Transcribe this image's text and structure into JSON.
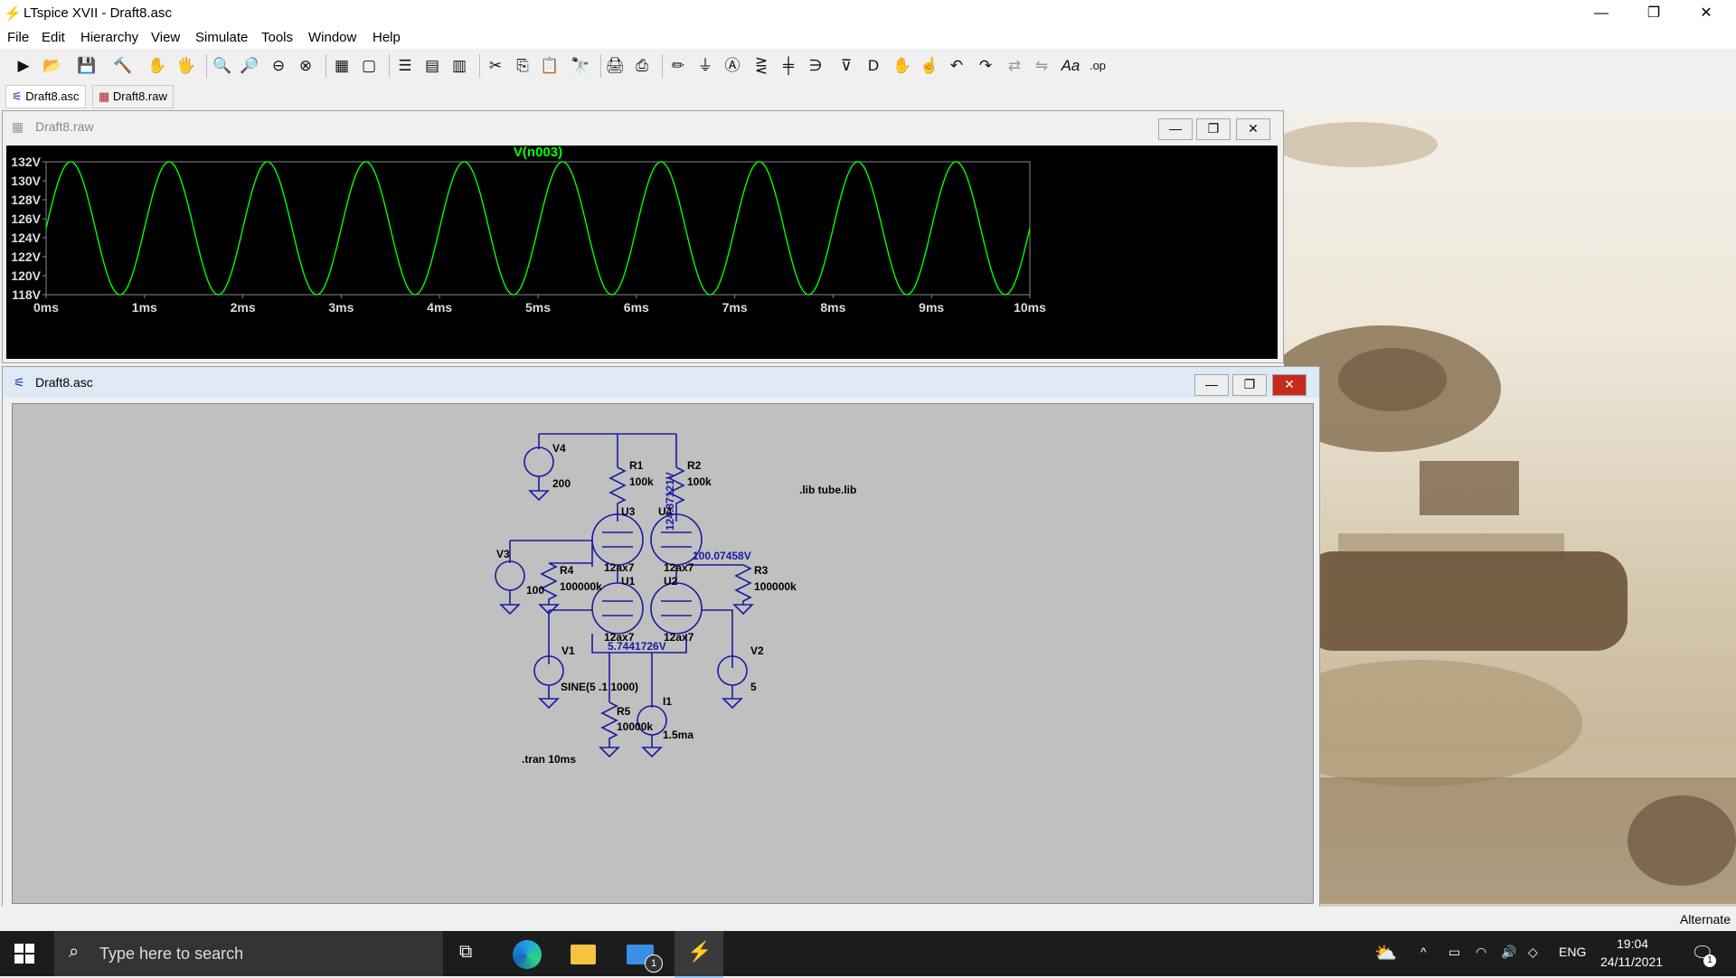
{
  "app": {
    "title": "LTspice XVII - Draft8.asc",
    "status_right": "Alternate"
  },
  "menu": [
    "File",
    "Edit",
    "Hierarchy",
    "View",
    "Simulate",
    "Tools",
    "Window",
    "Help"
  ],
  "tabs": [
    {
      "label": "Draft8.asc"
    },
    {
      "label": "Draft8.raw"
    }
  ],
  "plot_window": {
    "title": "Draft8.raw",
    "trace_label": "V(n003)",
    "trace_color": "#00ff00",
    "background": "#000000"
  },
  "chart_data": {
    "type": "line",
    "title": "V(n003)",
    "series": [
      {
        "name": "V(n003)",
        "frequency_hz": 1000,
        "offset_v": 125,
        "amplitude_v": 7,
        "phase": "peak at ~0.25ms"
      }
    ],
    "x_ticks": [
      "0ms",
      "1ms",
      "2ms",
      "3ms",
      "4ms",
      "5ms",
      "6ms",
      "7ms",
      "8ms",
      "9ms",
      "10ms"
    ],
    "y_ticks": [
      "132V",
      "130V",
      "128V",
      "126V",
      "124V",
      "122V",
      "120V",
      "118V"
    ],
    "xlim": [
      0,
      10
    ],
    "ylim": [
      118,
      132
    ],
    "x_unit": "ms",
    "y_unit": "V",
    "grid": false
  },
  "schematic_window": {
    "title": "Draft8.asc",
    "labels": {
      "v4": "V4",
      "v4_val": "200",
      "r1": "R1",
      "r1_val": "100k",
      "r2": "R2",
      "r2_val": "100k",
      "lib": ".lib tube.lib",
      "u3": "U3",
      "u4": "U4",
      "node_v1": "124.87121V",
      "node_v2": "100.07458V",
      "v3": "V3",
      "v3_val": "100",
      "r4": "R4",
      "r4_val": "100000k",
      "u3_model": "12ax7",
      "u4_model": "12ax7",
      "u1": "U1",
      "u2": "U2",
      "r3": "R3",
      "r3_val": "100000k",
      "u1_model": "12ax7",
      "u2_model": "12ax7",
      "node_v3": "5.7441726V",
      "v1": "V1",
      "v1_val": "SINE(5 .1 1000)",
      "v2": "V2",
      "v2_val": "5",
      "r5": "R5",
      "r5_val": "10000k",
      "i1": "I1",
      "i1_val": "1.5ma",
      "tran": ".tran 10ms"
    }
  },
  "taskbar": {
    "search_placeholder": "Type here to search",
    "lang": "ENG",
    "time": "19:04",
    "date": "24/11/2021",
    "notif_count": "1",
    "mail_badge": "1"
  }
}
